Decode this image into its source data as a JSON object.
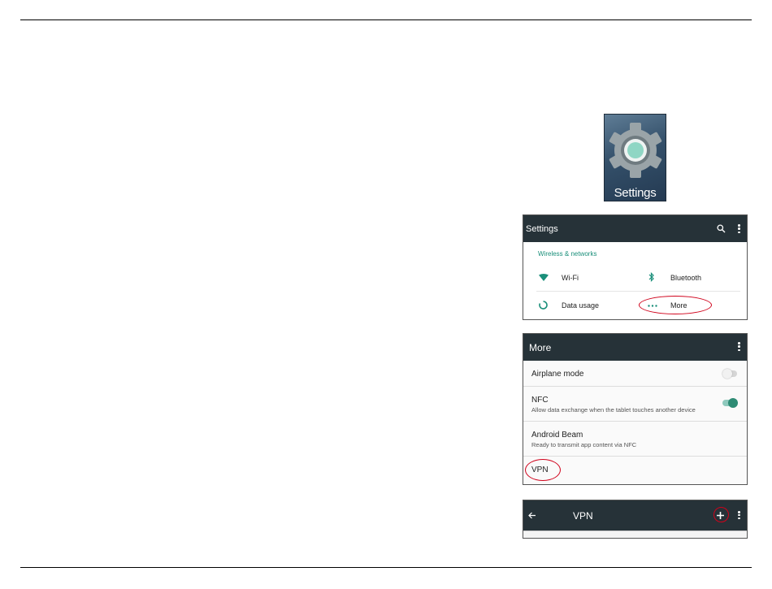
{
  "app_icon": {
    "label": "Settings",
    "icon": "gear-icon"
  },
  "settings_panel": {
    "title": "Settings",
    "section_header": "Wireless & networks",
    "items": [
      {
        "label": "Wi-Fi",
        "icon": "wifi-icon"
      },
      {
        "label": "Bluetooth",
        "icon": "bluetooth-icon"
      },
      {
        "label": "Data usage",
        "icon": "data-usage-icon"
      },
      {
        "label": "More",
        "icon": "more-dots-icon"
      }
    ],
    "accent_color": "#1a8f7a",
    "toolbar_color": "#263238"
  },
  "more_panel": {
    "title": "More",
    "rows": [
      {
        "title": "Airplane mode",
        "subtitle": "",
        "toggle": "off"
      },
      {
        "title": "NFC",
        "subtitle": "Allow data exchange when the tablet touches another device",
        "toggle": "on"
      },
      {
        "title": "Android Beam",
        "subtitle": "Ready to transmit app content via NFC"
      },
      {
        "title": "VPN",
        "subtitle": ""
      }
    ]
  },
  "vpn_panel": {
    "title": "VPN"
  },
  "annotation_color": "#d0021b"
}
